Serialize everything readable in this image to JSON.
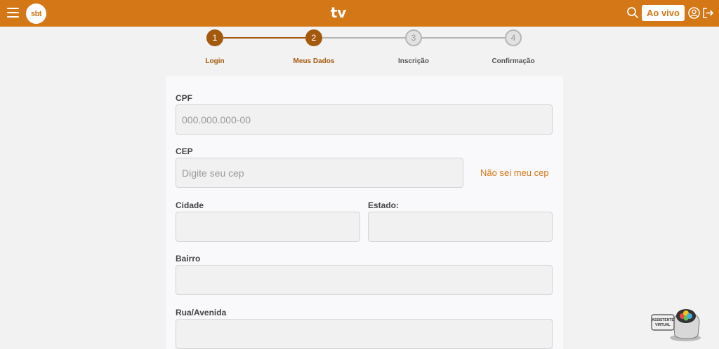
{
  "header": {
    "logo_text": "sbt",
    "brand_text": "tv",
    "live_button_label": "Ao vivo",
    "accent_color": "#d47716"
  },
  "stepper": {
    "steps": [
      {
        "number": "1",
        "label": "Login",
        "status": "done"
      },
      {
        "number": "2",
        "label": "Meus Dados",
        "status": "done"
      },
      {
        "number": "3",
        "label": "Inscrição",
        "status": "todo"
      },
      {
        "number": "4",
        "label": "Confirmação",
        "status": "todo"
      }
    ]
  },
  "form": {
    "cpf": {
      "label": "CPF",
      "placeholder": "000.000.000-00",
      "value": ""
    },
    "cep": {
      "label": "CEP",
      "placeholder": "Digite seu cep",
      "value": "",
      "link_text": "Não sei meu cep"
    },
    "cidade": {
      "label": "Cidade",
      "value": ""
    },
    "estado": {
      "label": "Estado:",
      "value": ""
    },
    "bairro": {
      "label": "Bairro",
      "value": ""
    },
    "rua": {
      "label": "Rua/Avenida",
      "value": ""
    }
  },
  "assistant": {
    "badge_text": "ASSISTENTE VIRTUAL"
  }
}
